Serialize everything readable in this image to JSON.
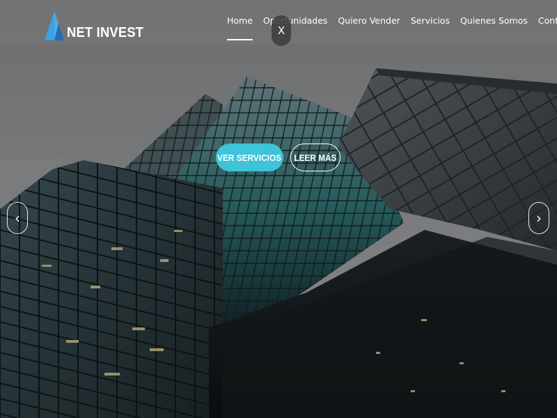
{
  "brand": {
    "name": "NET INVEST",
    "logo_icon": "triangle-logo-icon",
    "accent": "#3ec3d9"
  },
  "nav": {
    "items": [
      {
        "label": "Home",
        "active": true
      },
      {
        "label": "Oportunidades",
        "active": false
      },
      {
        "label": "Quiero Vender",
        "active": false
      },
      {
        "label": "Servicios",
        "active": false
      },
      {
        "label": "Quienes Somos",
        "active": false
      },
      {
        "label": "Contactos",
        "active": false
      }
    ]
  },
  "overlay": {
    "close_label": "X"
  },
  "hero": {
    "primary_cta": "VER SERVICIOS",
    "secondary_cta": "LEER MÁS",
    "prev_icon": "chevron-left-icon",
    "next_icon": "chevron-right-icon",
    "prev_glyph": "‹",
    "next_glyph": "›"
  }
}
